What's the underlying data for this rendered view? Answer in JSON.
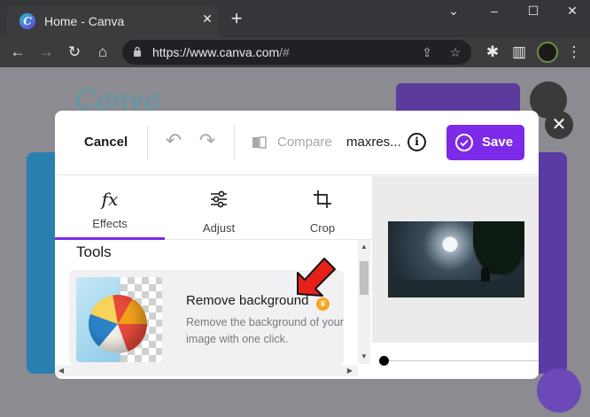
{
  "browser": {
    "tab_title": "Home - Canva",
    "favicon_letter": "C",
    "url_host": "https://www.canva.com",
    "url_rest": "/#",
    "window_controls": [
      "–",
      "☐",
      "✕"
    ]
  },
  "dialog": {
    "cancel_label": "Cancel",
    "compare_label": "Compare",
    "filename": "maxres...",
    "info_symbol": "i",
    "save_label": "Save",
    "tabs": [
      {
        "icon": "fx",
        "label": "Effects",
        "active": true
      },
      {
        "icon": "sliders",
        "label": "Adjust",
        "active": false
      },
      {
        "icon": "crop",
        "label": "Crop",
        "active": false
      }
    ],
    "tools_heading": "Tools",
    "tool": {
      "title": "Remove background",
      "description": "Remove the background of your image with one click.",
      "premium_badge": "crown"
    },
    "slider_value": 0
  },
  "colors": {
    "accent": "#7d2ae8",
    "crown": "#f4a621",
    "annotation_arrow": "#e8201a"
  }
}
